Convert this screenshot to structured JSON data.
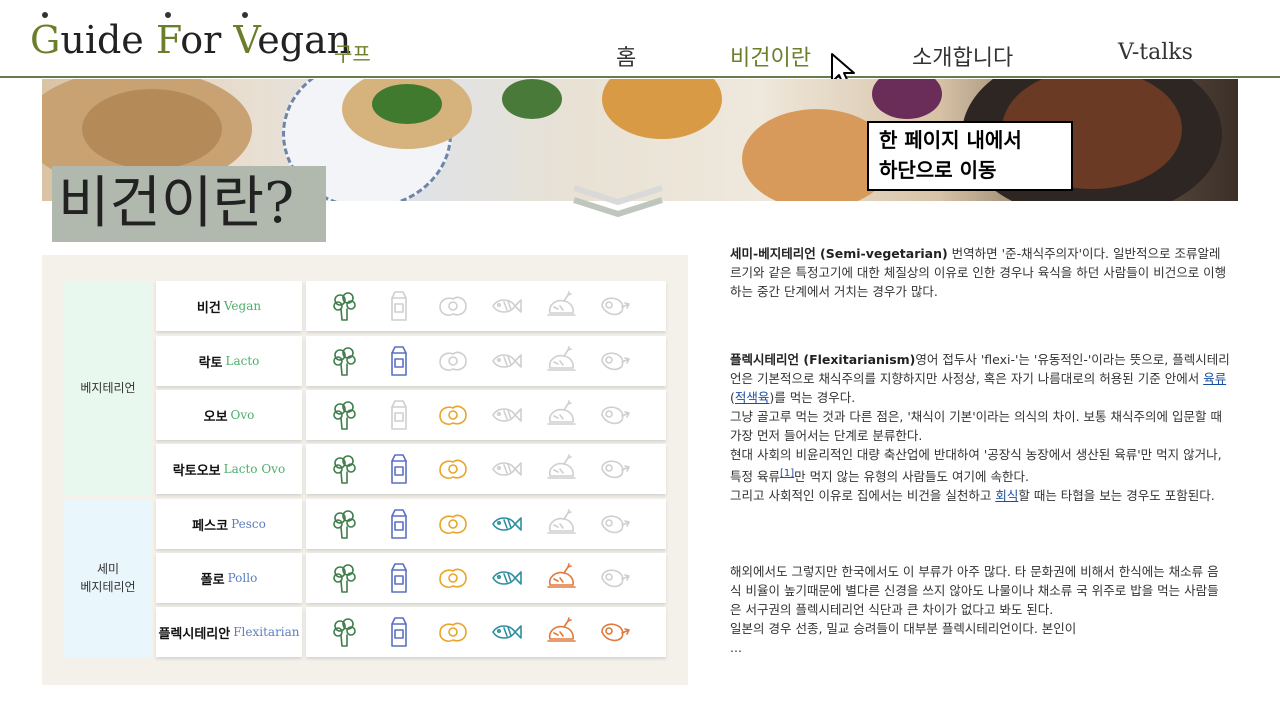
{
  "header": {
    "logo_parts": [
      "G",
      "uide ",
      "F",
      "or ",
      "V",
      "egan"
    ],
    "logo_sub": "구프",
    "nav": [
      "홈",
      "비건이란",
      "소개합니다",
      "V-talks"
    ],
    "active_nav": "비건이란"
  },
  "banner": {
    "callout_line1": "한 페이지 내에서",
    "callout_line2": "하단으로 이동"
  },
  "page_title": "비건이란?",
  "table": {
    "categories": [
      {
        "label_lines": [
          "베지테리언"
        ],
        "color": "#e8f8ee"
      },
      {
        "label_lines": [
          "세미",
          "베지테리언"
        ],
        "color": "#e9f6fb"
      }
    ],
    "rows": [
      {
        "ko": "비건",
        "en": "Vegan",
        "en_color": "#4caf6a",
        "active": [
          true,
          false,
          false,
          false,
          false,
          false
        ]
      },
      {
        "ko": "락토",
        "en": "Lacto",
        "en_color": "#4caf6a",
        "active": [
          true,
          true,
          false,
          false,
          false,
          false
        ]
      },
      {
        "ko": "오보",
        "en": "Ovo",
        "en_color": "#4caf6a",
        "active": [
          true,
          false,
          true,
          false,
          false,
          false
        ]
      },
      {
        "ko": "락토오보",
        "en": "Lacto Ovo",
        "en_color": "#4caf6a",
        "active": [
          true,
          true,
          true,
          false,
          false,
          false
        ]
      },
      {
        "ko": "페스코",
        "en": "Pesco",
        "en_color": "#5a7fc0",
        "active": [
          true,
          true,
          true,
          true,
          false,
          false
        ]
      },
      {
        "ko": "폴로",
        "en": "Pollo",
        "en_color": "#5a7fc0",
        "active": [
          true,
          true,
          true,
          true,
          true,
          false
        ]
      },
      {
        "ko": "플렉시테리안",
        "en": "Flexitarian",
        "en_color": "#5a7fc0",
        "active": [
          true,
          true,
          true,
          true,
          true,
          true
        ]
      }
    ],
    "icons": [
      "broccoli-icon",
      "milk-carton-icon",
      "egg-icon",
      "fish-icon",
      "chicken-icon",
      "ham-icon"
    ],
    "icon_colors": [
      "#3f7d4a",
      "#5b6fc4",
      "#e8a52a",
      "#2f8fa0",
      "#e07a3c",
      "#e07a3c"
    ],
    "inactive_color": "#cfcfcf"
  },
  "text": {
    "p1_bold": "세미-베지테리언 (Semi-vegetarian)",
    "p1_rest": " 번역하면 '준-채식주의자'이다. 일반적으로 조류알레르기와 같은 특정고기에 대한 체질상의 이유로 인한 경우나 육식을 하던 사람들이 비건으로 이행하는 중간 단계에서 거치는 경우가 많다.",
    "p2_bold": "플렉시테리언 (Flexitarianism)",
    "p2_a": "영어 접두사 'flexi-'는 '유동적인-'이라는 뜻으로, 플렉시테리언은 기본적으로 채식주의를 지향하지만 사정상, 혹은 자기 나름대로의 허용된 기준 안에서 ",
    "p2_link1": "육류",
    "p2_b": "(",
    "p2_link2": "적색육",
    "p2_c": ")를 먹는 경우다.",
    "p2_d": "그냥 골고루 먹는 것과 다른 점은, '채식이 기본'이라는 의식의 차이. 보통 채식주의에 입문할 때 가장 먼저 들어서는 단계로 분류한다.",
    "p2_e": "현대 사회의 비윤리적인 대량 축산업에 반대하여 '공장식 농장에서 생산된 육류'만 먹지 않거나, 특정 육류",
    "p2_ref": "[1]",
    "p2_f": "만 먹지 않는 유형의 사람들도 여기에 속한다.",
    "p2_g": "그리고 사회적인 이유로 집에서는 비건을 실천하고 ",
    "p2_link3": "회식",
    "p2_h": "할 때는 타협을 보는 경우도 포함된다.",
    "p3": "해외에서도 그렇지만 한국에서도 이 부류가 아주 많다. 타 문화권에 비해서 한식에는 채소류 음식 비율이 높기때문에 별다른 신경을 쓰지 않아도 나물이나 채소류 국 위주로 밥을 먹는 사람들은 서구권의 플렉시테리언 식단과 큰 차이가 없다고 봐도 된다.",
    "p4": "일본의 경우 선종, 밀교 승려들이 대부분 플렉시테리언이다. 본인이",
    "ellipsis": "..."
  }
}
